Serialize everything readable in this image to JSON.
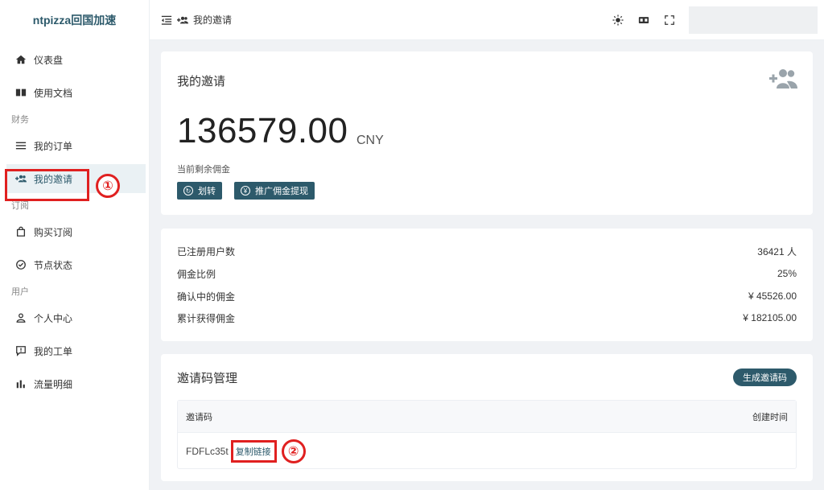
{
  "brand": "ntpizza回国加速",
  "sidebar": {
    "items": [
      {
        "label": "仪表盘",
        "icon": "home-icon"
      },
      {
        "label": "使用文档",
        "icon": "book-icon"
      },
      {
        "section": "财务"
      },
      {
        "label": "我的订单",
        "icon": "list-icon"
      },
      {
        "label": "我的邀请",
        "icon": "invite-icon",
        "active": true
      },
      {
        "section": "订阅"
      },
      {
        "label": "购买订阅",
        "icon": "bag-icon"
      },
      {
        "label": "节点状态",
        "icon": "check-circle-icon"
      },
      {
        "section": "用户"
      },
      {
        "label": "个人中心",
        "icon": "person-icon"
      },
      {
        "label": "我的工单",
        "icon": "ticket-icon"
      },
      {
        "label": "流量明细",
        "icon": "bar-chart-icon"
      }
    ]
  },
  "header": {
    "title": "我的邀请",
    "icons": [
      "theme-sun-icon",
      "translate-icon",
      "fullscreen-icon"
    ]
  },
  "commission": {
    "title": "我的邀请",
    "amount": "136579.00",
    "currency": "CNY",
    "label": "当前剩余佣金",
    "transfer_btn": "划转",
    "withdraw_btn": "推广佣金提现"
  },
  "stats": [
    {
      "label": "已注册用户数",
      "value": "36421 人"
    },
    {
      "label": "佣金比例",
      "value": "25%"
    },
    {
      "label": "确认中的佣金",
      "value": "¥ 45526.00"
    },
    {
      "label": "累计获得佣金",
      "value": "¥ 182105.00"
    }
  ],
  "invite_codes": {
    "title": "邀请码管理",
    "generate_btn": "生成邀请码",
    "col_code": "邀请码",
    "col_time": "创建时间",
    "rows": [
      {
        "code": "FDFLc35t",
        "copy_label": "复制链接"
      }
    ]
  },
  "annotations": {
    "marker1": "①",
    "marker2": "②",
    "color": "#e02020"
  },
  "theme": {
    "accent": "#2d5a6b"
  }
}
